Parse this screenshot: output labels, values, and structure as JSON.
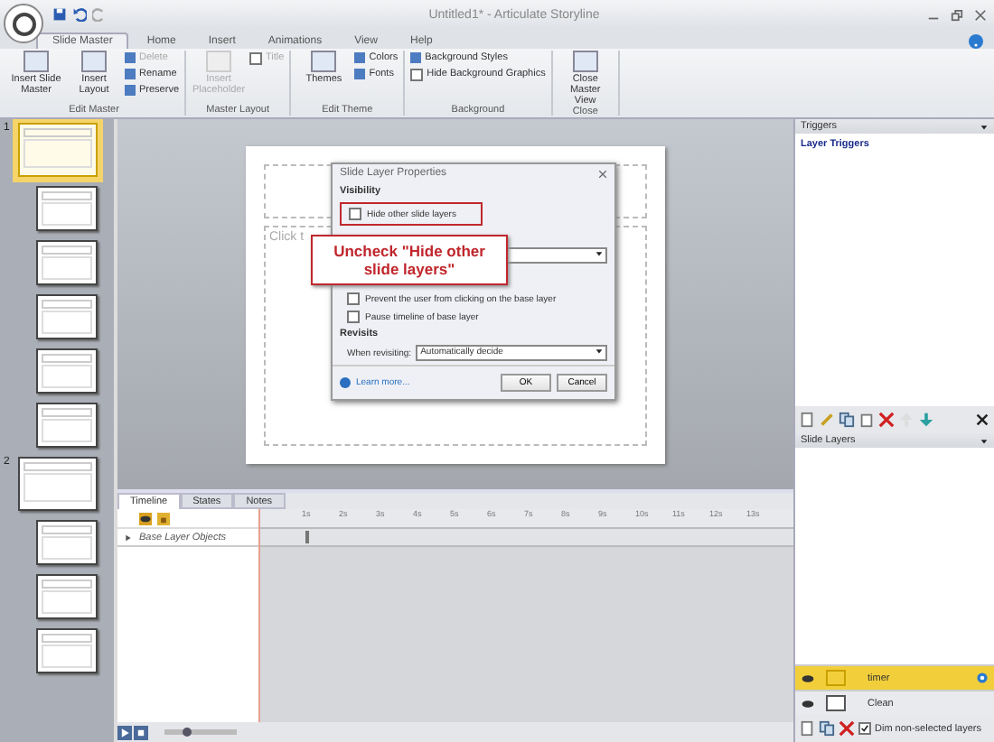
{
  "window": {
    "title": "Untitled1* - Articulate Storyline"
  },
  "ribbon_tabs": [
    {
      "label": "Slide Master",
      "selected": true
    },
    {
      "label": "Home",
      "selected": false
    },
    {
      "label": "Insert",
      "selected": false
    },
    {
      "label": "Animations",
      "selected": false
    },
    {
      "label": "View",
      "selected": false
    },
    {
      "label": "Help",
      "selected": false
    }
  ],
  "ribbon_groups": [
    {
      "label": "Edit Master",
      "items": [
        {
          "kind": "large",
          "label": "Insert Slide Master",
          "disabled": false
        },
        {
          "kind": "large",
          "label": "Insert Layout",
          "disabled": false
        },
        {
          "kind": "stack",
          "items": [
            {
              "kind": "small",
              "label": "Delete",
              "disabled": true
            },
            {
              "kind": "small",
              "label": "Rename",
              "disabled": false
            },
            {
              "kind": "small",
              "label": "Preserve",
              "disabled": false
            }
          ]
        }
      ]
    },
    {
      "label": "Master Layout",
      "items": [
        {
          "kind": "large",
          "label": "Insert Placeholder",
          "disabled": true
        },
        {
          "kind": "stack",
          "items": [
            {
              "kind": "check",
              "label": "Title",
              "disabled": true,
              "checked": false
            }
          ]
        }
      ]
    },
    {
      "label": "Edit Theme",
      "items": [
        {
          "kind": "large",
          "label": "Themes",
          "disabled": false
        },
        {
          "kind": "stack",
          "items": [
            {
              "kind": "small",
              "label": "Colors",
              "disabled": false
            },
            {
              "kind": "small",
              "label": "Fonts",
              "disabled": false
            }
          ]
        }
      ]
    },
    {
      "label": "Background",
      "items": [
        {
          "kind": "stack",
          "items": [
            {
              "kind": "small",
              "label": "Background Styles",
              "disabled": false
            },
            {
              "kind": "check",
              "label": "Hide Background Graphics",
              "disabled": false,
              "checked": false
            }
          ]
        }
      ]
    },
    {
      "label": "Close",
      "items": [
        {
          "kind": "large",
          "label": "Close Master View",
          "disabled": false
        }
      ]
    }
  ],
  "thumbnails": [
    {
      "kind": "master",
      "number": "1",
      "selected": true
    },
    {
      "kind": "layout",
      "selected": false
    },
    {
      "kind": "layout",
      "selected": false
    },
    {
      "kind": "layout",
      "selected": false
    },
    {
      "kind": "layout",
      "selected": false
    },
    {
      "kind": "layout",
      "selected": false
    },
    {
      "kind": "master",
      "number": "2",
      "selected": false
    },
    {
      "kind": "layout",
      "selected": false
    },
    {
      "kind": "layout",
      "selected": false
    },
    {
      "kind": "layout",
      "selected": false
    }
  ],
  "slide": {
    "placeholder": "Click t"
  },
  "dialog": {
    "title": "Slide Layer Properties",
    "visibility_heading": "Visibility",
    "hide_other_layers": {
      "label": "Hide other slide layers",
      "checked": false
    },
    "base_layer_options": [
      {
        "label": "Prevent the user from clicking on the base layer",
        "checked": false
      },
      {
        "label": "Pause timeline of base layer",
        "checked": false
      }
    ],
    "revisits_heading": "Revisits",
    "revisit_label": "When revisiting:",
    "revisit_value": "Automatically decide",
    "learn_more": "Learn more...",
    "buttons": [
      "OK",
      "Cancel"
    ]
  },
  "callout": {
    "text": "Uncheck \"Hide other slide layers\""
  },
  "bottom_tabs": [
    {
      "label": "Timeline",
      "selected": true
    },
    {
      "label": "States",
      "selected": false
    },
    {
      "label": "Notes",
      "selected": false
    }
  ],
  "timeline": {
    "zoom": {
      "level": 0.3
    },
    "row": "Base Layer Objects",
    "ticks": [
      "1s",
      "2s",
      "3s",
      "4s",
      "5s",
      "6s",
      "7s",
      "8s",
      "9s",
      "10s",
      "11s",
      "12s",
      "13s"
    ]
  },
  "triggers": {
    "title": "Triggers",
    "items": [
      "Layer Triggers"
    ]
  },
  "slide_layers": {
    "title": "Slide Layers",
    "layers": [
      {
        "name": "timer",
        "selected": true
      },
      {
        "name": "Clean",
        "selected": false
      }
    ],
    "dim_option": {
      "label": "Dim non-selected layers",
      "checked": true
    }
  }
}
